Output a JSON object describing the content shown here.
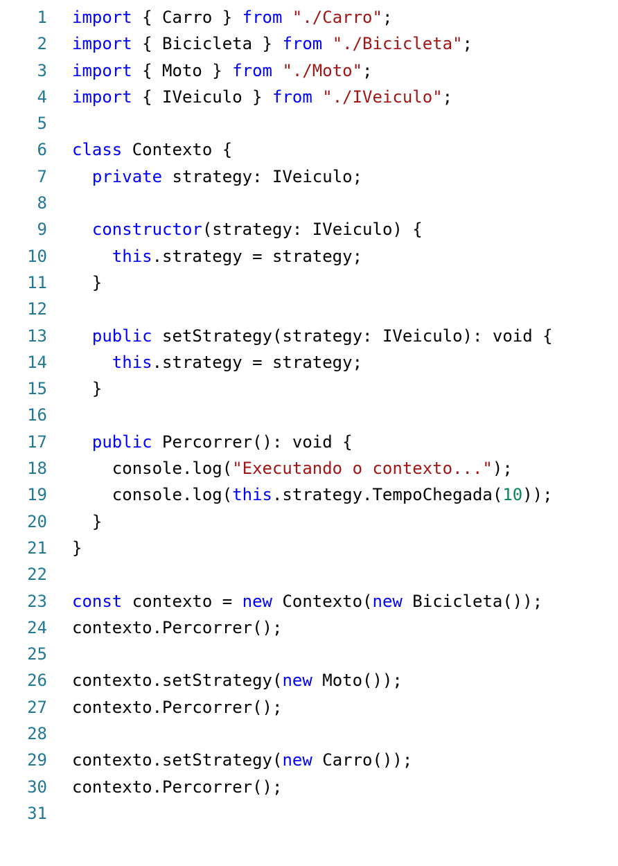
{
  "editor": {
    "colors": {
      "line_number": "#237893",
      "keyword": "#0000ff",
      "string": "#a31515",
      "number": "#098658",
      "text": "#000000",
      "background": "#ffffff"
    },
    "lines": [
      {
        "n": "1",
        "tokens": [
          {
            "t": "kw",
            "v": "import"
          },
          {
            "t": "tx",
            "v": " { Carro } "
          },
          {
            "t": "kw",
            "v": "from"
          },
          {
            "t": "tx",
            "v": " "
          },
          {
            "t": "str",
            "v": "\"./Carro\""
          },
          {
            "t": "tx",
            "v": ";"
          }
        ]
      },
      {
        "n": "2",
        "tokens": [
          {
            "t": "kw",
            "v": "import"
          },
          {
            "t": "tx",
            "v": " { Bicicleta } "
          },
          {
            "t": "kw",
            "v": "from"
          },
          {
            "t": "tx",
            "v": " "
          },
          {
            "t": "str",
            "v": "\"./Bicicleta\""
          },
          {
            "t": "tx",
            "v": ";"
          }
        ]
      },
      {
        "n": "3",
        "tokens": [
          {
            "t": "kw",
            "v": "import"
          },
          {
            "t": "tx",
            "v": " { Moto } "
          },
          {
            "t": "kw",
            "v": "from"
          },
          {
            "t": "tx",
            "v": " "
          },
          {
            "t": "str",
            "v": "\"./Moto\""
          },
          {
            "t": "tx",
            "v": ";"
          }
        ]
      },
      {
        "n": "4",
        "tokens": [
          {
            "t": "kw",
            "v": "import"
          },
          {
            "t": "tx",
            "v": " { IVeiculo } "
          },
          {
            "t": "kw",
            "v": "from"
          },
          {
            "t": "tx",
            "v": " "
          },
          {
            "t": "str",
            "v": "\"./IVeiculo\""
          },
          {
            "t": "tx",
            "v": ";"
          }
        ]
      },
      {
        "n": "5",
        "tokens": []
      },
      {
        "n": "6",
        "tokens": [
          {
            "t": "kw",
            "v": "class"
          },
          {
            "t": "tx",
            "v": " Contexto {"
          }
        ]
      },
      {
        "n": "7",
        "tokens": [
          {
            "t": "tx",
            "v": "  "
          },
          {
            "t": "kw",
            "v": "private"
          },
          {
            "t": "tx",
            "v": " strategy: IVeiculo;"
          }
        ]
      },
      {
        "n": "8",
        "tokens": []
      },
      {
        "n": "9",
        "tokens": [
          {
            "t": "tx",
            "v": "  "
          },
          {
            "t": "kw",
            "v": "constructor"
          },
          {
            "t": "tx",
            "v": "(strategy: IVeiculo) {"
          }
        ]
      },
      {
        "n": "10",
        "tokens": [
          {
            "t": "tx",
            "v": "    "
          },
          {
            "t": "kw",
            "v": "this"
          },
          {
            "t": "tx",
            "v": ".strategy = strategy;"
          }
        ]
      },
      {
        "n": "11",
        "tokens": [
          {
            "t": "tx",
            "v": "  }"
          }
        ]
      },
      {
        "n": "12",
        "tokens": []
      },
      {
        "n": "13",
        "tokens": [
          {
            "t": "tx",
            "v": "  "
          },
          {
            "t": "kw",
            "v": "public"
          },
          {
            "t": "tx",
            "v": " setStrategy(strategy: IVeiculo): void {"
          }
        ]
      },
      {
        "n": "14",
        "tokens": [
          {
            "t": "tx",
            "v": "    "
          },
          {
            "t": "kw",
            "v": "this"
          },
          {
            "t": "tx",
            "v": ".strategy = strategy;"
          }
        ]
      },
      {
        "n": "15",
        "tokens": [
          {
            "t": "tx",
            "v": "  }"
          }
        ]
      },
      {
        "n": "16",
        "tokens": []
      },
      {
        "n": "17",
        "tokens": [
          {
            "t": "tx",
            "v": "  "
          },
          {
            "t": "kw",
            "v": "public"
          },
          {
            "t": "tx",
            "v": " Percorrer(): void {"
          }
        ]
      },
      {
        "n": "18",
        "tokens": [
          {
            "t": "tx",
            "v": "    console.log("
          },
          {
            "t": "str",
            "v": "\"Executando o contexto...\""
          },
          {
            "t": "tx",
            "v": ");"
          }
        ]
      },
      {
        "n": "19",
        "tokens": [
          {
            "t": "tx",
            "v": "    console.log("
          },
          {
            "t": "kw",
            "v": "this"
          },
          {
            "t": "tx",
            "v": ".strategy.TempoChegada("
          },
          {
            "t": "num",
            "v": "10"
          },
          {
            "t": "tx",
            "v": "));"
          }
        ]
      },
      {
        "n": "20",
        "tokens": [
          {
            "t": "tx",
            "v": "  }"
          }
        ]
      },
      {
        "n": "21",
        "tokens": [
          {
            "t": "tx",
            "v": "}"
          }
        ]
      },
      {
        "n": "22",
        "tokens": []
      },
      {
        "n": "23",
        "tokens": [
          {
            "t": "kw",
            "v": "const"
          },
          {
            "t": "tx",
            "v": " contexto = "
          },
          {
            "t": "kw",
            "v": "new"
          },
          {
            "t": "tx",
            "v": " Contexto("
          },
          {
            "t": "kw",
            "v": "new"
          },
          {
            "t": "tx",
            "v": " Bicicleta());"
          }
        ]
      },
      {
        "n": "24",
        "tokens": [
          {
            "t": "tx",
            "v": "contexto.Percorrer();"
          }
        ]
      },
      {
        "n": "25",
        "tokens": []
      },
      {
        "n": "26",
        "tokens": [
          {
            "t": "tx",
            "v": "contexto.setStrategy("
          },
          {
            "t": "kw",
            "v": "new"
          },
          {
            "t": "tx",
            "v": " Moto());"
          }
        ]
      },
      {
        "n": "27",
        "tokens": [
          {
            "t": "tx",
            "v": "contexto.Percorrer();"
          }
        ]
      },
      {
        "n": "28",
        "tokens": []
      },
      {
        "n": "29",
        "tokens": [
          {
            "t": "tx",
            "v": "contexto.setStrategy("
          },
          {
            "t": "kw",
            "v": "new"
          },
          {
            "t": "tx",
            "v": " Carro());"
          }
        ]
      },
      {
        "n": "30",
        "tokens": [
          {
            "t": "tx",
            "v": "contexto.Percorrer();"
          }
        ]
      },
      {
        "n": "31",
        "tokens": []
      }
    ]
  }
}
